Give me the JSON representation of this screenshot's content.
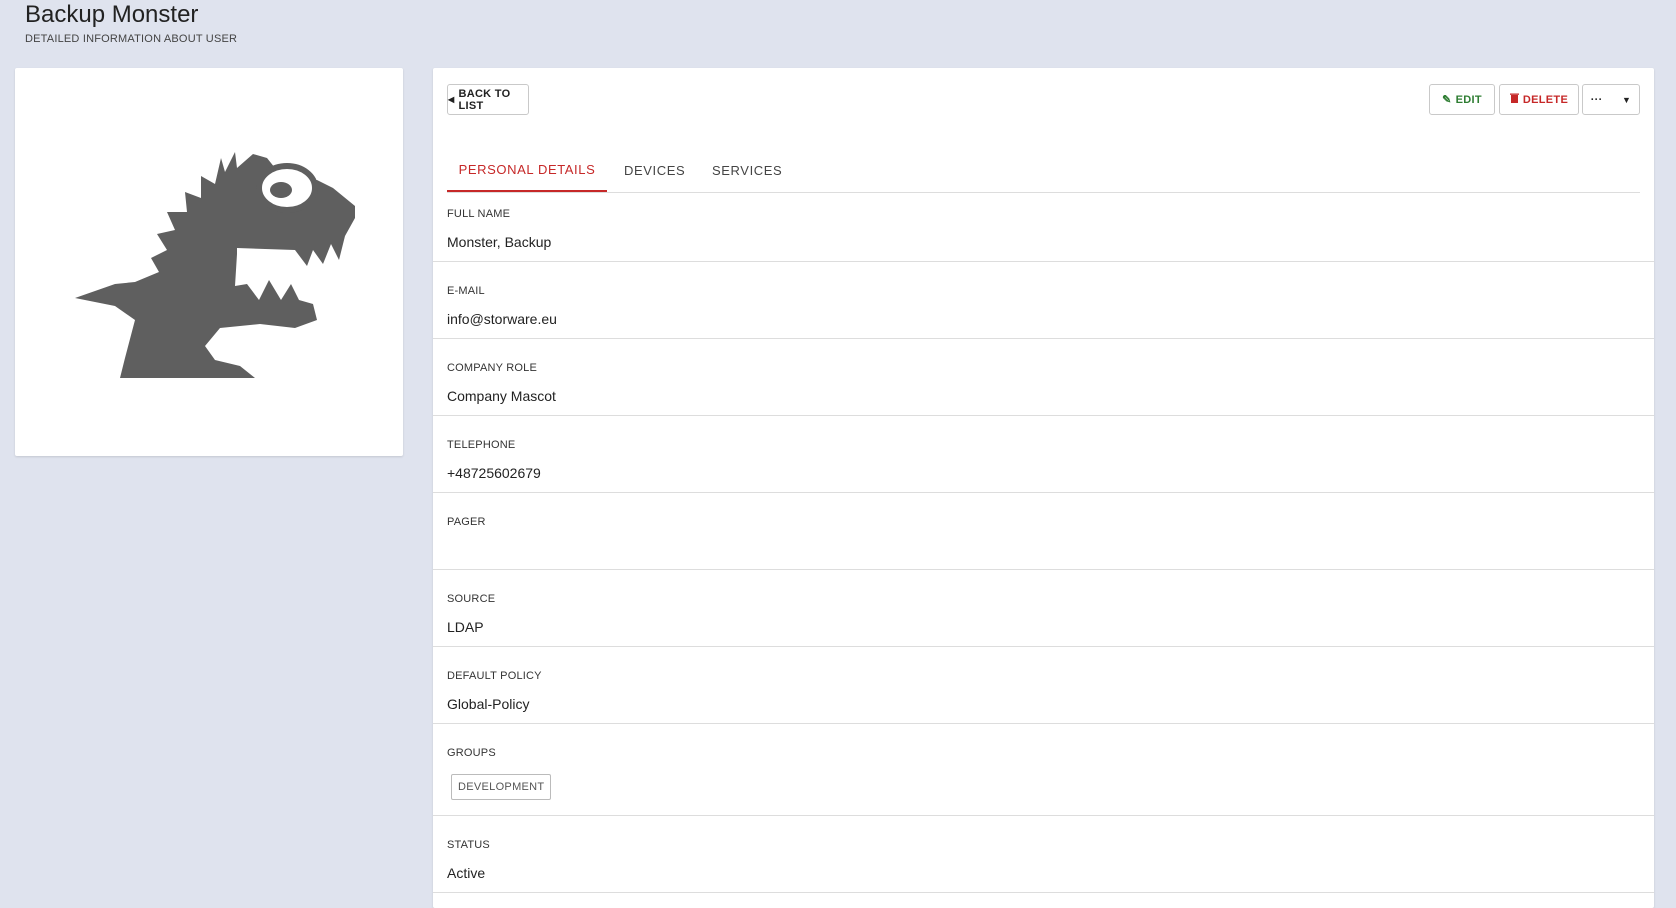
{
  "header": {
    "title": "Backup Monster",
    "subtitle": "DETAILED INFORMATION ABOUT USER"
  },
  "avatar": {
    "description": "monster-mascot-image"
  },
  "toolbar": {
    "back_label": "BACK TO LIST",
    "edit_label": "EDIT",
    "delete_label": "DELETE",
    "more_label": "···"
  },
  "tabs": [
    {
      "label": "PERSONAL DETAILS",
      "active": true
    },
    {
      "label": "DEVICES",
      "active": false
    },
    {
      "label": "SERVICES",
      "active": false
    }
  ],
  "fields": {
    "full_name": {
      "label": "FULL NAME",
      "value": "Monster, Backup"
    },
    "email": {
      "label": "E-MAIL",
      "value": "info@storware.eu"
    },
    "company_role": {
      "label": "COMPANY ROLE",
      "value": "Company Mascot"
    },
    "telephone": {
      "label": "TELEPHONE",
      "value": "+48725602679"
    },
    "pager": {
      "label": "PAGER",
      "value": ""
    },
    "source": {
      "label": "SOURCE",
      "value": "LDAP"
    },
    "default_policy": {
      "label": "DEFAULT POLICY",
      "value": "Global-Policy"
    },
    "groups": {
      "label": "GROUPS",
      "items": [
        "DEVELOPMENT"
      ]
    },
    "status": {
      "label": "STATUS",
      "value": "Active"
    }
  },
  "colors": {
    "background": "#dfe3ee",
    "accent_red": "#c62828",
    "edit_green": "#2e7d32"
  }
}
